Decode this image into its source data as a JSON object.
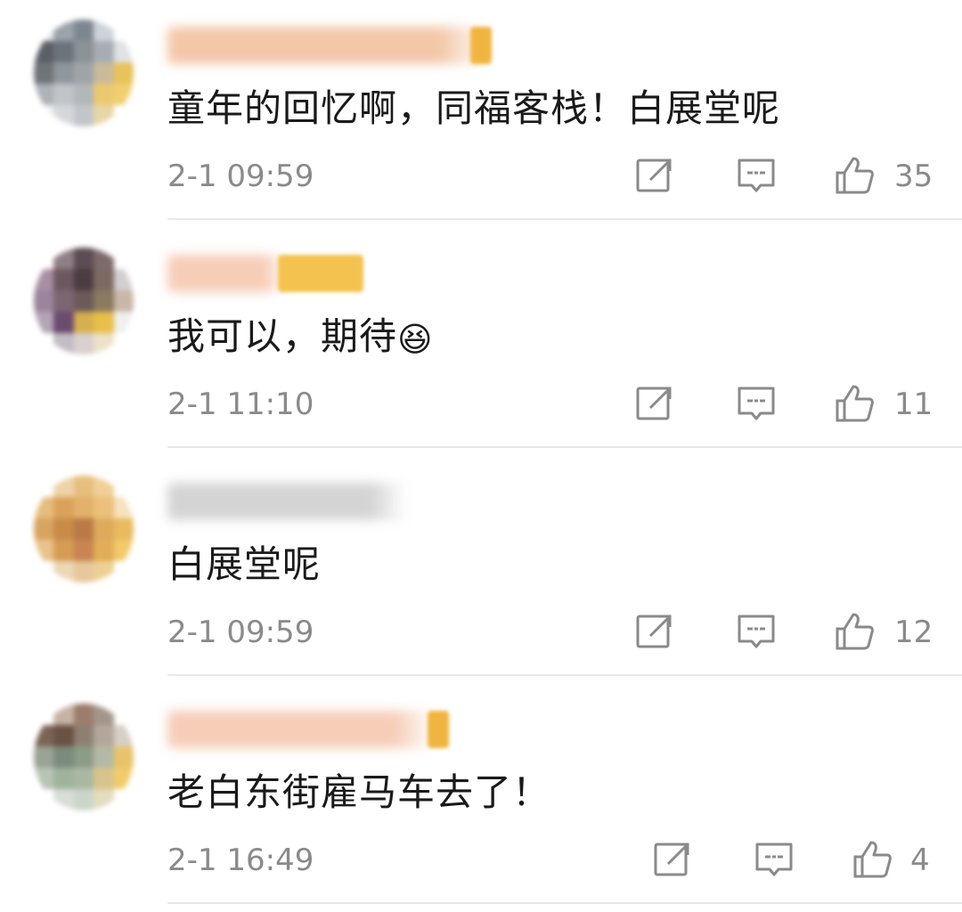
{
  "comments": [
    {
      "text": "童年的回忆啊，同福客栈！白展堂呢",
      "time": "2-1 09:59",
      "likes": "35",
      "avatar_colors": [
        "#e8e8e8",
        "#9aa4ad",
        "#7e8790",
        "#cdd3d8",
        "#ffffff",
        "#5a5f66",
        "#6c737a",
        "#8b9298",
        "#a7adb3",
        "#e0e3e6",
        "#707378",
        "#8f969c",
        "#9fa4a9",
        "#c9ba9a",
        "#e8c35a",
        "#adb2b7",
        "#c1c4c8",
        "#b3b6ba",
        "#eac96e",
        "#f1cf70",
        "#eef0f2",
        "#d5d8db",
        "#c2c6ca",
        "#e7d7a6",
        "#ffffff"
      ],
      "name_color": "#f3c7a8",
      "name_width": 360
    },
    {
      "text": "我可以，期待",
      "emoji": "😆",
      "time": "2-1 11:10",
      "likes": "11",
      "avatar_colors": [
        "#ffffff",
        "#8f7f86",
        "#5d4c53",
        "#7f6a6a",
        "#ffffff",
        "#a98fa3",
        "#6c5760",
        "#4b3c40",
        "#7c6a62",
        "#d4cfcf",
        "#9b859c",
        "#7d6673",
        "#6d5a58",
        "#8b7a5f",
        "#c8b7a8",
        "#b4a4b7",
        "#6a4c6f",
        "#d6b04f",
        "#e8bf49",
        "#f0f0f0",
        "#ffffff",
        "#c2bcc4",
        "#d9d0cf",
        "#ede1c8",
        "#ffffff"
      ],
      "name_color": "#f6cdb7",
      "name_width": 130
    },
    {
      "text": "白展堂呢",
      "time": "2-1 09:59",
      "likes": "12",
      "avatar_colors": [
        "#ffffff",
        "#efd3a8",
        "#e7be7e",
        "#f0cf97",
        "#ffffff",
        "#e5bd7e",
        "#d9a25a",
        "#e2b16a",
        "#ecc079",
        "#f6e3bf",
        "#d8a45f",
        "#c88b48",
        "#b97a45",
        "#deaa5c",
        "#e9ba5f",
        "#e8c38a",
        "#d69b55",
        "#c98452",
        "#e2ad58",
        "#f3c969",
        "#ffffff",
        "#ecd7b7",
        "#e6c89a",
        "#ecd194",
        "#ffffff"
      ],
      "name_color": "#d4d4d4",
      "name_width": 268
    },
    {
      "text": "老白东街雇马车去了！",
      "time": "2-1 16:49",
      "likes": "4",
      "avatar_colors": [
        "#ffffff",
        "#c7b3a4",
        "#9c7d6b",
        "#a4958a",
        "#ffffff",
        "#7b6454",
        "#6a5245",
        "#8f7f73",
        "#b3a79b",
        "#d8cfc6",
        "#9ba396",
        "#7c8c7c",
        "#8b9c88",
        "#b3b9a4",
        "#e7c46c",
        "#b8c4b5",
        "#9fb39d",
        "#aab8a2",
        "#d9c38c",
        "#f0cc6a",
        "#ffffff",
        "#d8ded5",
        "#ccd5c9",
        "#e4dcbd",
        "#ffffff"
      ],
      "name_color": "#f6cdb7",
      "name_width": 300
    }
  ],
  "icons": {
    "share": "share-icon",
    "comment": "comment-icon",
    "like": "thumbs-up-icon"
  }
}
